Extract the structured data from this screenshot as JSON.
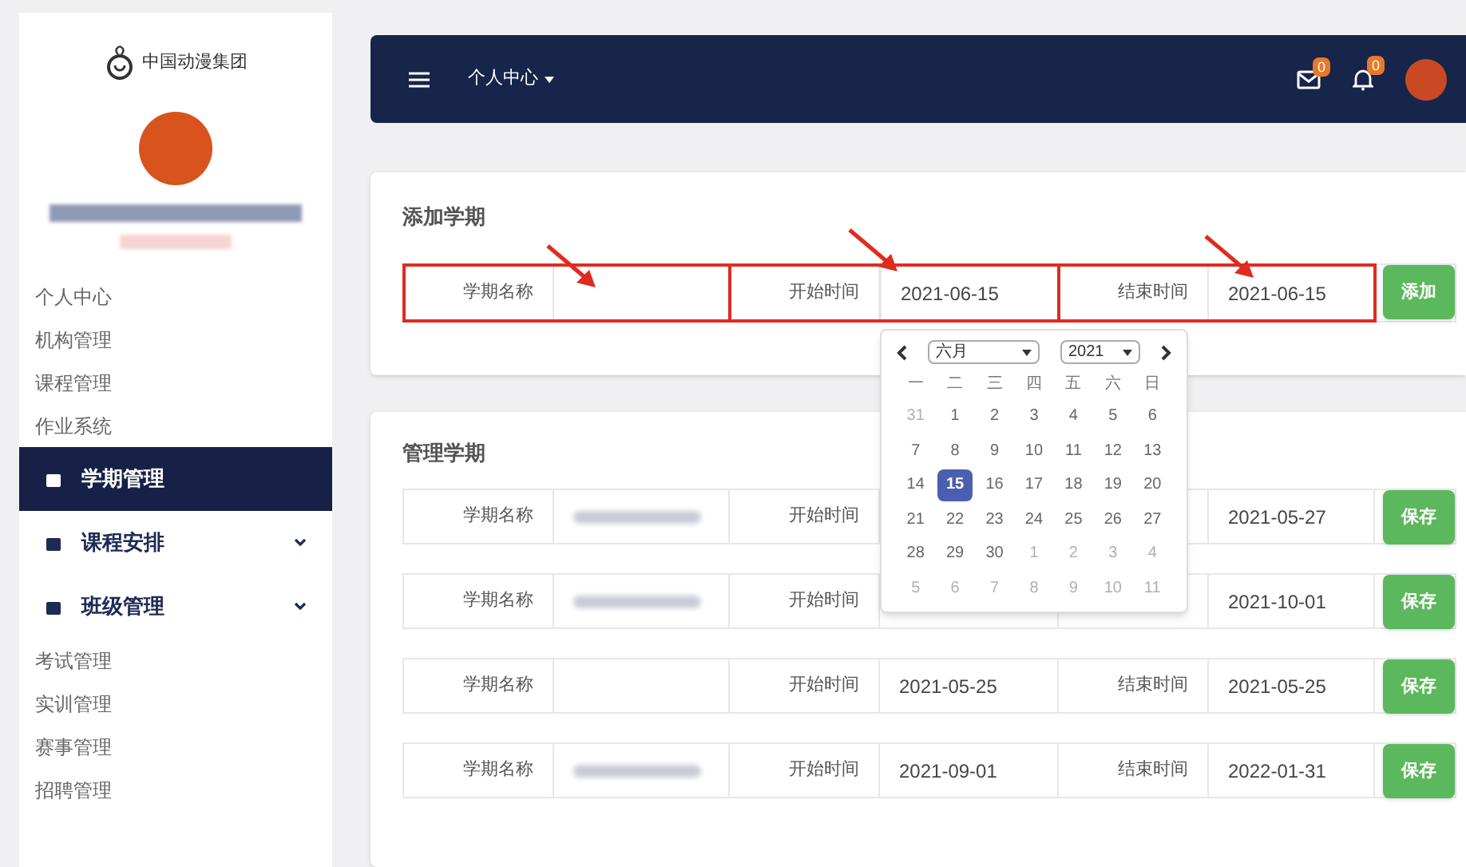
{
  "sidebar": {
    "logo_text": "中国动漫集团",
    "items": [
      {
        "label": "个人中心",
        "kind": "link",
        "selected": false
      },
      {
        "label": "机构管理",
        "kind": "link",
        "selected": false
      },
      {
        "label": "课程管理",
        "kind": "link",
        "selected": false
      },
      {
        "label": "作业系统",
        "kind": "link",
        "selected": false
      },
      {
        "label": "学期管理",
        "kind": "section",
        "selected": true,
        "submenu": false
      },
      {
        "label": "课程安排",
        "kind": "section",
        "selected": false,
        "submenu": true
      },
      {
        "label": "班级管理",
        "kind": "section",
        "selected": false,
        "submenu": true
      },
      {
        "label": "考试管理",
        "kind": "link",
        "selected": false
      },
      {
        "label": "实训管理",
        "kind": "link",
        "selected": false
      },
      {
        "label": "赛事管理",
        "kind": "link",
        "selected": false
      },
      {
        "label": "招聘管理",
        "kind": "link",
        "selected": false
      }
    ]
  },
  "header": {
    "menu": "个人中心",
    "mail_badge": "0",
    "bell_badge": "0"
  },
  "add_term": {
    "title": "添加学期",
    "name_label": "学期名称",
    "start_label": "开始时间",
    "start_value": "2021-06-15",
    "end_label": "结束时间",
    "end_value": "2021-06-15",
    "button": "添加"
  },
  "datepicker": {
    "month": "六月",
    "year": "2021",
    "weekdays": [
      "一",
      "二",
      "三",
      "四",
      "五",
      "六",
      "日"
    ],
    "days": [
      {
        "label": "31",
        "muted": true,
        "selected": false
      },
      {
        "label": "1",
        "muted": false,
        "selected": false
      },
      {
        "label": "2",
        "muted": false,
        "selected": false
      },
      {
        "label": "3",
        "muted": false,
        "selected": false
      },
      {
        "label": "4",
        "muted": false,
        "selected": false
      },
      {
        "label": "5",
        "muted": false,
        "selected": false
      },
      {
        "label": "6",
        "muted": false,
        "selected": false
      },
      {
        "label": "7",
        "muted": false,
        "selected": false
      },
      {
        "label": "8",
        "muted": false,
        "selected": false
      },
      {
        "label": "9",
        "muted": false,
        "selected": false
      },
      {
        "label": "10",
        "muted": false,
        "selected": false
      },
      {
        "label": "11",
        "muted": false,
        "selected": false
      },
      {
        "label": "12",
        "muted": false,
        "selected": false
      },
      {
        "label": "13",
        "muted": false,
        "selected": false
      },
      {
        "label": "14",
        "muted": false,
        "selected": false
      },
      {
        "label": "15",
        "muted": false,
        "selected": true
      },
      {
        "label": "16",
        "muted": false,
        "selected": false
      },
      {
        "label": "17",
        "muted": false,
        "selected": false
      },
      {
        "label": "18",
        "muted": false,
        "selected": false
      },
      {
        "label": "19",
        "muted": false,
        "selected": false
      },
      {
        "label": "20",
        "muted": false,
        "selected": false
      },
      {
        "label": "21",
        "muted": false,
        "selected": false
      },
      {
        "label": "22",
        "muted": false,
        "selected": false
      },
      {
        "label": "23",
        "muted": false,
        "selected": false
      },
      {
        "label": "24",
        "muted": false,
        "selected": false
      },
      {
        "label": "25",
        "muted": false,
        "selected": false
      },
      {
        "label": "26",
        "muted": false,
        "selected": false
      },
      {
        "label": "27",
        "muted": false,
        "selected": false
      },
      {
        "label": "28",
        "muted": false,
        "selected": false
      },
      {
        "label": "29",
        "muted": false,
        "selected": false
      },
      {
        "label": "30",
        "muted": false,
        "selected": false
      },
      {
        "label": "1",
        "muted": true,
        "selected": false
      },
      {
        "label": "2",
        "muted": true,
        "selected": false
      },
      {
        "label": "3",
        "muted": true,
        "selected": false
      },
      {
        "label": "4",
        "muted": true,
        "selected": false
      },
      {
        "label": "5",
        "muted": true,
        "selected": false
      },
      {
        "label": "6",
        "muted": true,
        "selected": false
      },
      {
        "label": "7",
        "muted": true,
        "selected": false
      },
      {
        "label": "8",
        "muted": true,
        "selected": false
      },
      {
        "label": "9",
        "muted": true,
        "selected": false
      },
      {
        "label": "10",
        "muted": true,
        "selected": false
      },
      {
        "label": "11",
        "muted": true,
        "selected": false
      }
    ]
  },
  "manage_terms": {
    "title": "管理学期",
    "rows": [
      {
        "name_label": "学期名称",
        "name_redacted": true,
        "start_label": "开始时间",
        "end_value": "2021-05-27",
        "button": "保存"
      },
      {
        "name_label": "学期名称",
        "name_redacted": true,
        "start_label": "开始时间",
        "end_value": "2021-10-01",
        "button": "保存"
      },
      {
        "name_label": "学期名称",
        "name_redacted": false,
        "start_label": "开始时间",
        "start_value": "2021-05-25",
        "end_label": "结束时间",
        "end_value": "2021-05-25",
        "button": "保存"
      },
      {
        "name_label": "学期名称",
        "name_redacted": true,
        "start_label": "开始时间",
        "start_value": "2021-09-01",
        "end_label": "结束时间",
        "end_value": "2022-01-31",
        "button": "保存"
      }
    ]
  }
}
